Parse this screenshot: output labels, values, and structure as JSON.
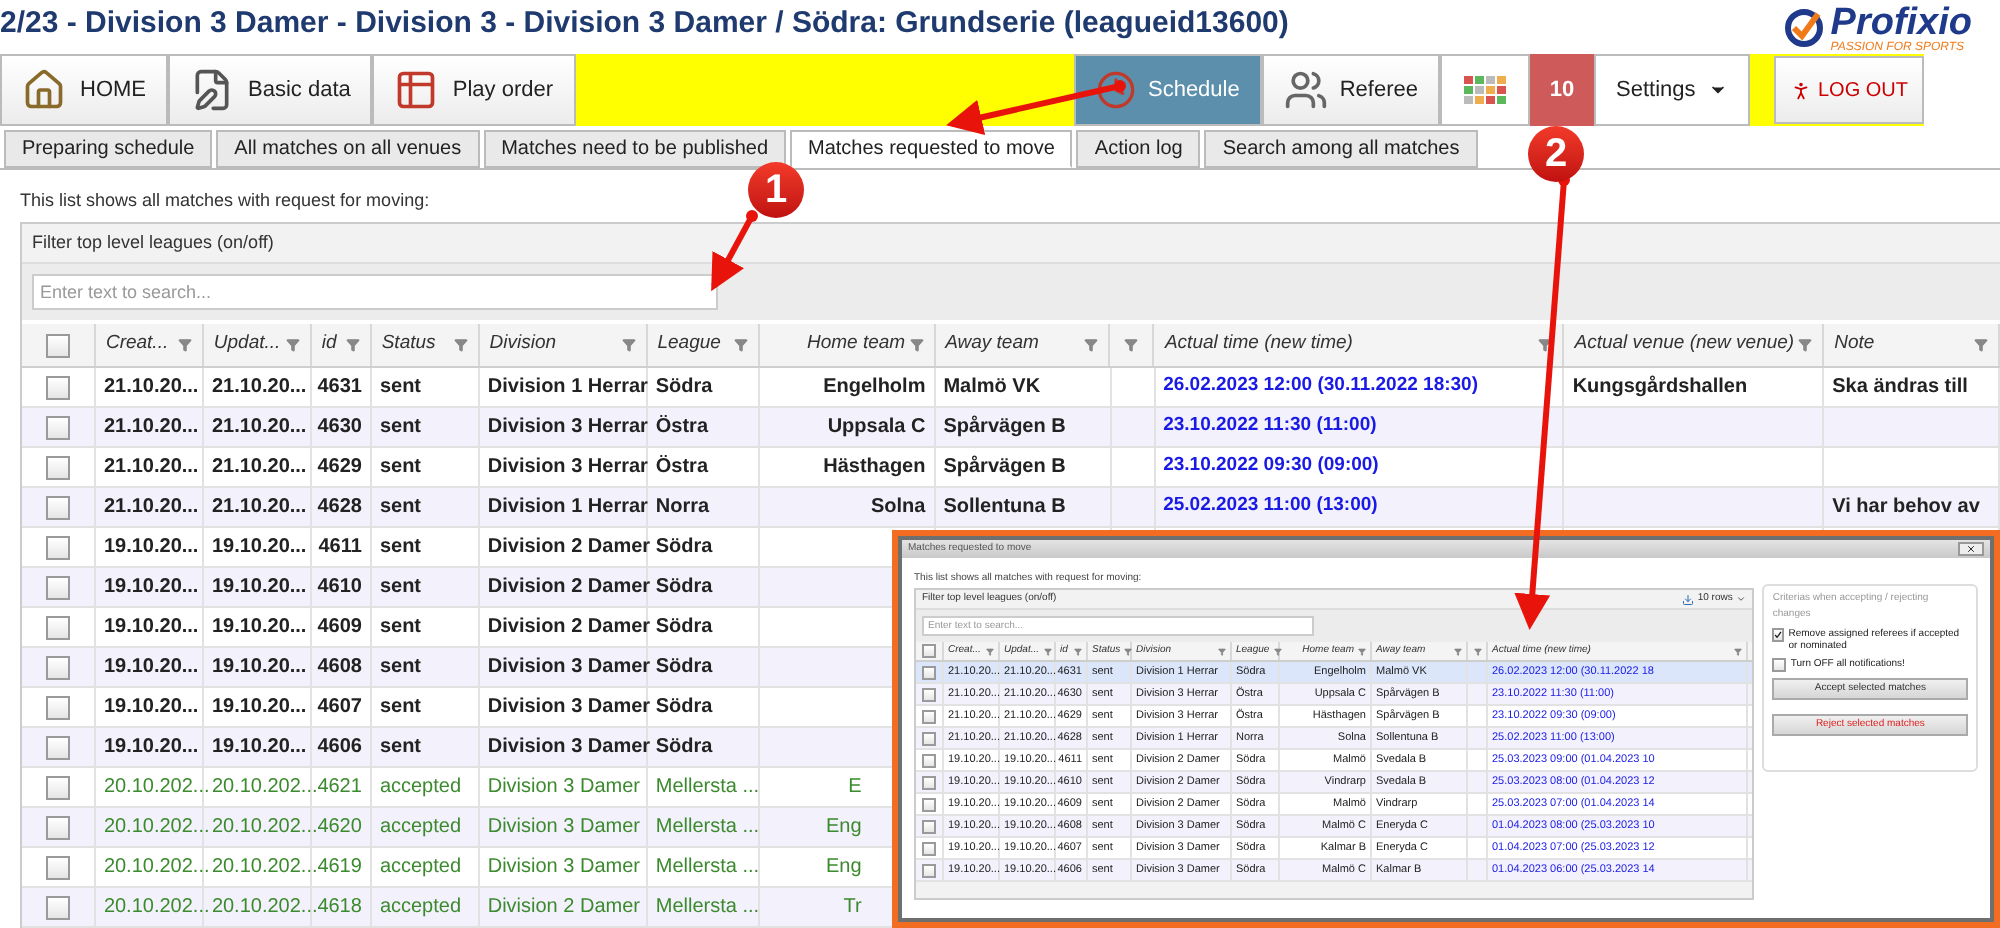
{
  "title": "2/23 - Division 3 Damer - Division 3 - Division 3 Damer / Södra: Grundserie (leagueid13600)",
  "logo": {
    "name": "Profixio",
    "tagline": "PASSION FOR SPORTS"
  },
  "toolbar": {
    "left": [
      {
        "label": "HOME",
        "kind": "home"
      },
      {
        "label": "Basic data",
        "kind": "basic"
      },
      {
        "label": "Play order",
        "kind": "order"
      }
    ],
    "right": [
      {
        "label": "Schedule",
        "kind": "schedule",
        "selected": true
      },
      {
        "label": "Referee",
        "kind": "referee",
        "selected": false
      }
    ],
    "badge": "10",
    "settings": "Settings",
    "logout": "LOG OUT"
  },
  "tabs": [
    {
      "label": "Preparing schedule",
      "selected": false
    },
    {
      "label": "All matches on all venues",
      "selected": false
    },
    {
      "label": "Matches need to be published",
      "selected": false
    },
    {
      "label": "Matches requested to move",
      "selected": true
    },
    {
      "label": "Action log",
      "selected": false
    },
    {
      "label": "Search among all matches",
      "selected": false
    }
  ],
  "intro": "This list shows all matches with request for moving:",
  "filter_label": "Filter top level leagues (on/off)",
  "search": {
    "placeholder": "Enter text to search..."
  },
  "select_all": {
    "checked": false
  },
  "columns": [
    {
      "kind": "text",
      "label": "Creat..."
    },
    {
      "kind": "text",
      "label": "Updat..."
    },
    {
      "kind": "text",
      "label": "id"
    },
    {
      "kind": "text",
      "label": "Status"
    },
    {
      "kind": "text",
      "label": "Division"
    },
    {
      "kind": "text",
      "label": "League"
    },
    {
      "kind": "right",
      "label": "Home team"
    },
    {
      "kind": "text",
      "label": "Away team"
    },
    {
      "kind": "filter"
    },
    {
      "kind": "text",
      "label": "Actual time (new time)"
    },
    {
      "kind": "text",
      "label": "Actual venue (new venue)"
    },
    {
      "kind": "text",
      "label": "Note"
    }
  ],
  "rows": [
    {
      "kind": "sent",
      "checked": false,
      "created": "21.10.20...",
      "updated": "21.10.20...",
      "id": "4631",
      "status": "sent",
      "division": "Division 1 Herrar",
      "league": "Södra",
      "home": "Engelholm",
      "away": "Malmö VK",
      "time": "26.02.2023 12:00 (30.11.2022 18:30)",
      "venue": "Kungsgårdshallen",
      "note": "Ska ändras till"
    },
    {
      "kind": "sent",
      "checked": false,
      "created": "21.10.20...",
      "updated": "21.10.20...",
      "id": "4630",
      "status": "sent",
      "division": "Division 3 Herrar",
      "league": "Östra",
      "home": "Uppsala C",
      "away": "Spårvägen B",
      "time": "23.10.2022 11:30 (11:00)"
    },
    {
      "kind": "sent",
      "checked": false,
      "created": "21.10.20...",
      "updated": "21.10.20...",
      "id": "4629",
      "status": "sent",
      "division": "Division 3 Herrar",
      "league": "Östra",
      "home": "Hästhagen",
      "away": "Spårvägen B",
      "time": "23.10.2022 09:30 (09:00)"
    },
    {
      "kind": "sent",
      "checked": false,
      "created": "21.10.20...",
      "updated": "21.10.20...",
      "id": "4628",
      "status": "sent",
      "division": "Division 1 Herrar",
      "league": "Norra",
      "home": "Solna",
      "away": "Sollentuna B",
      "time": "25.02.2023 11:00 (13:00)",
      "note": "Vi har behov av"
    },
    {
      "kind": "sent",
      "checked": false,
      "created": "19.10.20...",
      "updated": "19.10.20...",
      "id": "4611",
      "status": "sent",
      "division": "Division 2 Damer",
      "league": "Södra"
    },
    {
      "kind": "sent",
      "checked": false,
      "created": "19.10.20...",
      "updated": "19.10.20...",
      "id": "4610",
      "status": "sent",
      "division": "Division 2 Damer",
      "league": "Södra"
    },
    {
      "kind": "sent",
      "checked": false,
      "created": "19.10.20...",
      "updated": "19.10.20...",
      "id": "4609",
      "status": "sent",
      "division": "Division 2 Damer",
      "league": "Södra"
    },
    {
      "kind": "sent",
      "checked": false,
      "created": "19.10.20...",
      "updated": "19.10.20...",
      "id": "4608",
      "status": "sent",
      "division": "Division 3 Damer",
      "league": "Södra"
    },
    {
      "kind": "sent",
      "checked": false,
      "created": "19.10.20...",
      "updated": "19.10.20...",
      "id": "4607",
      "status": "sent",
      "division": "Division 3 Damer",
      "league": "Södra"
    },
    {
      "kind": "sent",
      "checked": false,
      "created": "19.10.20...",
      "updated": "19.10.20...",
      "id": "4606",
      "status": "sent",
      "division": "Division 3 Damer",
      "league": "Södra"
    },
    {
      "kind": "accepted",
      "checked": false,
      "created": "20.10.202...",
      "updated": "20.10.202...",
      "id": "4621",
      "status": "accepted",
      "division": "Division 3 Damer",
      "league": "Mellersta ...",
      "home": "E"
    },
    {
      "kind": "accepted",
      "checked": false,
      "created": "20.10.202...",
      "updated": "20.10.202...",
      "id": "4620",
      "status": "accepted",
      "division": "Division 3 Damer",
      "league": "Mellersta ...",
      "home": "Eng"
    },
    {
      "kind": "accepted",
      "checked": false,
      "created": "20.10.202...",
      "updated": "20.10.202...",
      "id": "4619",
      "status": "accepted",
      "division": "Division 3 Damer",
      "league": "Mellersta ...",
      "home": "Eng"
    },
    {
      "kind": "accepted",
      "checked": false,
      "created": "20.10.202...",
      "updated": "20.10.202...",
      "id": "4618",
      "status": "accepted",
      "division": "Division 2 Damer",
      "league": "Mellersta ...",
      "home": "Tr"
    }
  ],
  "dialog": {
    "title": "Matches requested to move",
    "intro": "This list shows all matches with request for moving:",
    "filter_label": "Filter top level leagues (on/off)",
    "rows_label": "10 rows",
    "search": {
      "placeholder": "Enter text to search..."
    },
    "select_all": {
      "checked": false
    },
    "columns": [
      {
        "kind": "text",
        "label": "Creat..."
      },
      {
        "kind": "text",
        "label": "Updat..."
      },
      {
        "kind": "text",
        "label": "id"
      },
      {
        "kind": "text",
        "label": "Status"
      },
      {
        "kind": "text",
        "label": "Division"
      },
      {
        "kind": "text",
        "label": "League"
      },
      {
        "kind": "right",
        "label": "Home team"
      },
      {
        "kind": "text",
        "label": "Away team"
      },
      {
        "kind": "filter"
      },
      {
        "kind": "text",
        "label": "Actual time (new time)"
      }
    ],
    "rows": [
      {
        "selected": true,
        "checked": false,
        "created": "21.10.20...",
        "updated": "21.10.20...",
        "id": "4631",
        "status": "sent",
        "division": "Division 1 Herrar",
        "league": "Södra",
        "home": "Engelholm",
        "away": "Malmö VK",
        "time": "26.02.2023 12:00 (30.11.2022 18"
      },
      {
        "selected": false,
        "checked": false,
        "created": "21.10.20...",
        "updated": "21.10.20...",
        "id": "4630",
        "status": "sent",
        "division": "Division 3 Herrar",
        "league": "Östra",
        "home": "Uppsala C",
        "away": "Spårvägen B",
        "time": "23.10.2022 11:30 (11:00)"
      },
      {
        "selected": false,
        "checked": false,
        "created": "21.10.20...",
        "updated": "21.10.20...",
        "id": "4629",
        "status": "sent",
        "division": "Division 3 Herrar",
        "league": "Östra",
        "home": "Hästhagen",
        "away": "Spårvägen B",
        "time": "23.10.2022 09:30 (09:00)"
      },
      {
        "selected": false,
        "checked": false,
        "created": "21.10.20...",
        "updated": "21.10.20...",
        "id": "4628",
        "status": "sent",
        "division": "Division 1 Herrar",
        "league": "Norra",
        "home": "Solna",
        "away": "Sollentuna B",
        "time": "25.02.2023 11:00 (13:00)"
      },
      {
        "selected": false,
        "checked": false,
        "created": "19.10.20...",
        "updated": "19.10.20...",
        "id": "4611",
        "status": "sent",
        "division": "Division 2 Damer",
        "league": "Södra",
        "home": "Malmö",
        "away": "Svedala B",
        "time": "25.03.2023 09:00 (01.04.2023 10"
      },
      {
        "selected": false,
        "checked": false,
        "created": "19.10.20...",
        "updated": "19.10.20...",
        "id": "4610",
        "status": "sent",
        "division": "Division 2 Damer",
        "league": "Södra",
        "home": "Vindrarp",
        "away": "Svedala B",
        "time": "25.03.2023 08:00 (01.04.2023 12"
      },
      {
        "selected": false,
        "checked": false,
        "created": "19.10.20...",
        "updated": "19.10.20...",
        "id": "4609",
        "status": "sent",
        "division": "Division 2 Damer",
        "league": "Södra",
        "home": "Malmö",
        "away": "Vindrarp",
        "time": "25.03.2023 07:00 (01.04.2023 14"
      },
      {
        "selected": false,
        "checked": false,
        "created": "19.10.20...",
        "updated": "19.10.20...",
        "id": "4608",
        "status": "sent",
        "division": "Division 3 Damer",
        "league": "Södra",
        "home": "Malmö C",
        "away": "Eneryda C",
        "time": "01.04.2023 08:00 (25.03.2023 10"
      },
      {
        "selected": false,
        "checked": false,
        "created": "19.10.20...",
        "updated": "19.10.20...",
        "id": "4607",
        "status": "sent",
        "division": "Division 3 Damer",
        "league": "Södra",
        "home": "Kalmar B",
        "away": "Eneryda C",
        "time": "01.04.2023 07:00 (25.03.2023 12"
      },
      {
        "selected": false,
        "checked": false,
        "created": "19.10.20...",
        "updated": "19.10.20...",
        "id": "4606",
        "status": "sent",
        "division": "Division 3 Damer",
        "league": "Södra",
        "home": "Malmö C",
        "away": "Kalmar B",
        "time": "01.04.2023 06:00 (25.03.2023 14"
      }
    ],
    "panel": {
      "title": "Criterias when accepting / rejecting changes",
      "options": [
        {
          "label": "Remove assigned referees if accepted or nominated",
          "checked": true
        },
        {
          "label": "Turn OFF all notifications!",
          "checked": false
        }
      ],
      "buttons": [
        {
          "label": "Accept selected matches",
          "kind": "accept"
        },
        {
          "label": "Reject selected matches",
          "kind": "reject"
        }
      ]
    }
  },
  "annotations": [
    {
      "label": "1"
    },
    {
      "label": "2"
    }
  ]
}
